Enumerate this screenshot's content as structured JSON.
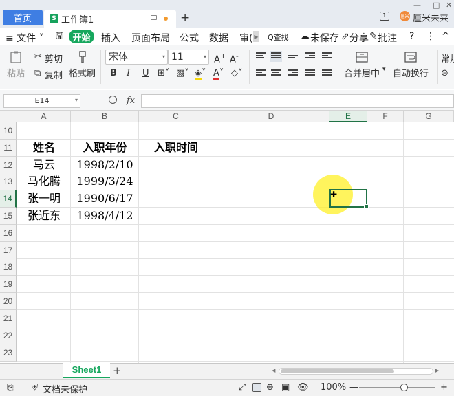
{
  "titlebar": {
    "home_tab": "首页",
    "workbook_tab": "工作簿1",
    "new_tab": "+",
    "username": "厘米未来",
    "avatar_text": "厘米"
  },
  "menu": {
    "file": "≡ 文件 ˅",
    "start": "开始",
    "insert": "插入",
    "page_layout": "页面布局",
    "formulas": "公式",
    "data": "数据",
    "review": "审(",
    "search": "Q查找",
    "unsaved": "未保存",
    "share": "分享",
    "comments": "批注",
    "help": "?",
    "more": "⋮",
    "collapse": "^"
  },
  "ribbon": {
    "paste": "粘贴",
    "cut": "剪切",
    "copy": "复制",
    "format_painter": "格式刷",
    "font_name": "宋体",
    "font_size": "11",
    "bold": "B",
    "italic": "I",
    "underline": "U",
    "merge_center": "合并居中",
    "wrap_text": "自动换行",
    "general": "常规"
  },
  "formula_bar": {
    "cell_ref": "E14",
    "fx": "fx",
    "content": ""
  },
  "grid": {
    "columns": [
      "A",
      "B",
      "C",
      "D",
      "E",
      "F",
      "G"
    ],
    "active_column": "E",
    "rows": [
      "10",
      "11",
      "12",
      "13",
      "14",
      "15",
      "16",
      "17",
      "18",
      "19",
      "20",
      "21",
      "22",
      "23"
    ],
    "active_row": "14",
    "header": [
      "姓名",
      "入职年份",
      "入职时间"
    ],
    "data": [
      [
        "马云",
        "1998/2/10"
      ],
      [
        "马化腾",
        "1999/3/24"
      ],
      [
        "张一明",
        "1990/6/17"
      ],
      [
        "张近东",
        "1998/4/12"
      ]
    ],
    "selected_cell": "E14"
  },
  "sheets": {
    "active": "Sheet1",
    "add": "+"
  },
  "status": {
    "doc_protect": "文档未保护",
    "zoom": "100%",
    "zoom_minus": "—",
    "zoom_plus": "+"
  },
  "colors": {
    "accent_green": "#17a75e",
    "home_blue": "#3f7ee3",
    "selection_green": "#217346",
    "cursor_highlight": "#fff01e"
  }
}
